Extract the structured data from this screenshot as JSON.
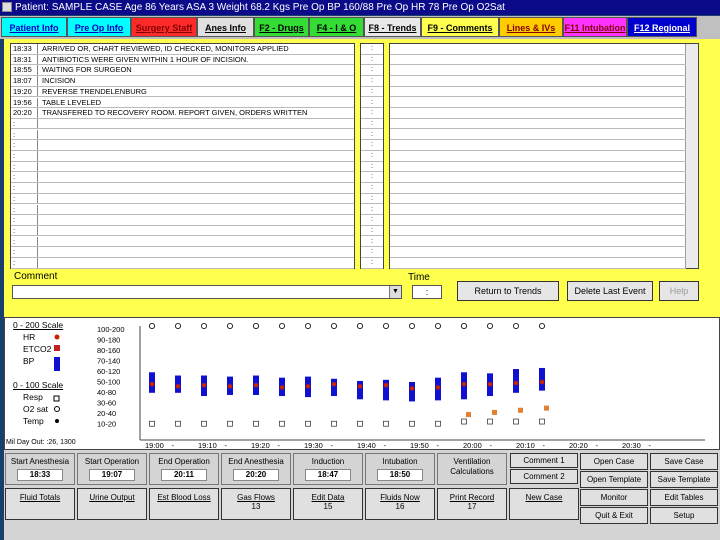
{
  "titlebar": {
    "text": "Patient: SAMPLE CASE   Age 86 Years   ASA 3   Weight 68.2 Kgs   Pre Op BP 160/88   Pre Op HR 78   Pre Op O2Sat"
  },
  "tabs": [
    {
      "label": "Patient Info",
      "bg": "#00ffff",
      "fg": "#0000c0"
    },
    {
      "label": "Pre Op Info",
      "bg": "#00ffff",
      "fg": "#0000c0"
    },
    {
      "label": "Surgery Staff",
      "bg": "#ff2a2a",
      "fg": "#800000"
    },
    {
      "label": "Anes Info",
      "bg": "#e0e0e0",
      "fg": "#000000"
    },
    {
      "label": "F2 - Drugs",
      "bg": "#33dd33",
      "fg": "#000000"
    },
    {
      "label": "F4 - I & O",
      "bg": "#33dd33",
      "fg": "#000000"
    },
    {
      "label": "F8 - Trends",
      "bg": "#e8e8e8",
      "fg": "#000000"
    },
    {
      "label": "F9 - Comments",
      "bg": "#ffff4d",
      "fg": "#000000"
    },
    {
      "label": "Lines & IVs",
      "bg": "#ffcc00",
      "fg": "#800000"
    },
    {
      "label": "F11 Intubation",
      "bg": "#ff33ff",
      "fg": "#800000"
    },
    {
      "label": "F12 Regional",
      "bg": "#0000cc",
      "fg": "#ffffff"
    }
  ],
  "comments": [
    {
      "time": "18:33",
      "text": "ARRIVED OR, CHART REVIEWED, ID CHECKED, MONITORS APPLIED"
    },
    {
      "time": "18:31",
      "text": "ANTIBIOTICS WERE GIVEN WITHIN 1 HOUR OF INCISION."
    },
    {
      "time": "18:55",
      "text": "WAITING FOR SURGEON"
    },
    {
      "time": "18:07",
      "text": "INCISION"
    },
    {
      "time": "19:20",
      "text": "REVERSE TRENDELENBURG"
    },
    {
      "time": "19:56",
      "text": "TABLE LEVELED"
    },
    {
      "time": "20:20",
      "text": "TRANSFERED TO RECOVERY ROOM. REPORT GIVEN, ORDERS WRITTEN"
    }
  ],
  "row_placeholder": ":",
  "comment_label": "Comment",
  "time_label": "Time",
  "time_value": ":",
  "buttons": {
    "return_to_trends": "Return to Trends",
    "delete_last_event": "Delete Last Event",
    "help": "Help"
  },
  "legend": {
    "scale_200": "0 - 200 Scale",
    "hr": "HR",
    "etco2": "ETCO2",
    "bp": "BP",
    "scale_100": "0 - 100 Scale",
    "resp": "Resp",
    "o2sat": "O2 sat",
    "temp": "Temp"
  },
  "axis_labels": [
    "100-200",
    "90-180",
    "80-160",
    "70-140",
    "60-120",
    "50-100",
    "40-80",
    "30-60",
    "20-40",
    "10-20"
  ],
  "footer_note": "Mil Day Out: :26, 1300",
  "chart_data": {
    "type": "line",
    "x": [
      "19:00",
      "19:05",
      "19:10",
      "19:15",
      "19:20",
      "19:25",
      "19:30",
      "19:35",
      "19:40",
      "19:45",
      "19:50",
      "19:55",
      "20:00",
      "20:05",
      "20:10",
      "20:15"
    ],
    "x_tick_labels": [
      "19:00",
      "-",
      "19:10",
      "-",
      "19:20",
      "-",
      "19:30",
      "-",
      "19:40",
      "-",
      "19:50",
      "-",
      "20:00",
      "-",
      "20:10",
      "-",
      "20:20",
      "-",
      "20:30",
      "-"
    ],
    "y_scale": "0 - 200",
    "bp_series": {
      "name": "BP",
      "systolic": [
        118,
        112,
        112,
        110,
        112,
        108,
        110,
        106,
        102,
        104,
        100,
        108,
        118,
        116,
        124,
        126
      ],
      "diastolic": [
        80,
        80,
        74,
        76,
        76,
        74,
        72,
        74,
        68,
        66,
        64,
        66,
        68,
        74,
        80,
        84
      ]
    },
    "hr_series": {
      "name": "HR",
      "values": [
        96,
        92,
        94,
        92,
        94,
        90,
        92,
        96,
        92,
        94,
        88,
        90,
        96,
        96,
        98,
        100
      ]
    },
    "o2sat_series": {
      "name": "O2 sat",
      "values": [
        100,
        100,
        100,
        100,
        100,
        100,
        100,
        100,
        100,
        100,
        100,
        100,
        100,
        100,
        100,
        100
      ]
    },
    "resp_series": {
      "name": "Resp",
      "values": [
        10,
        10,
        10,
        10,
        10,
        10,
        10,
        10,
        10,
        10,
        10,
        10,
        12,
        12,
        12,
        12
      ]
    },
    "temp_series": {
      "name": "Temp",
      "values": [
        36,
        36,
        36,
        36,
        36,
        36,
        36,
        36,
        36,
        36,
        36,
        36,
        36,
        36,
        36,
        36
      ]
    },
    "etco2_series": {
      "name": "ETCO2",
      "values": [
        null,
        null,
        null,
        null,
        null,
        null,
        null,
        null,
        null,
        null,
        null,
        null,
        24,
        26,
        28,
        30
      ]
    },
    "colors": {
      "bp": "#1010d0",
      "hr": "#cc2200",
      "etco2": "#e08030",
      "o2sat": "#000000"
    }
  },
  "events": [
    {
      "label": "Start Anesthesia",
      "value": "18:33"
    },
    {
      "label": "Start Operation",
      "value": "19:07"
    },
    {
      "label": "End Operation",
      "value": "20:11"
    },
    {
      "label": "End Anesthesia",
      "value": "20:20"
    },
    {
      "label": "Induction",
      "value": "18:47"
    },
    {
      "label": "Intubation",
      "value": "18:50"
    },
    {
      "label": "Ventilation Calculations",
      "value": ""
    }
  ],
  "bottom_row2": [
    {
      "label": "Fluid Totals",
      "sub": ""
    },
    {
      "label": "Urine Output",
      "sub": ""
    },
    {
      "label": "Est Blood Loss",
      "sub": ""
    },
    {
      "label": "Gas Flows",
      "sub": "13"
    },
    {
      "label": "Edit Data",
      "sub": "15"
    },
    {
      "label": "Fluids Now",
      "sub": "16"
    },
    {
      "label": "Print Record",
      "sub": "17"
    },
    {
      "label": "New Case",
      "sub": ""
    }
  ],
  "right_buttons": [
    {
      "label": "Comment 1"
    },
    {
      "label": "Comment 2"
    },
    {
      "label": "Open Case"
    },
    {
      "label": "Open Template"
    },
    {
      "label": "Monitor"
    },
    {
      "label": "Quit & Exit"
    },
    {
      "label": "Save Case"
    },
    {
      "label": "Save Template"
    },
    {
      "label": "Edit Tables"
    },
    {
      "label": "Setup"
    }
  ]
}
